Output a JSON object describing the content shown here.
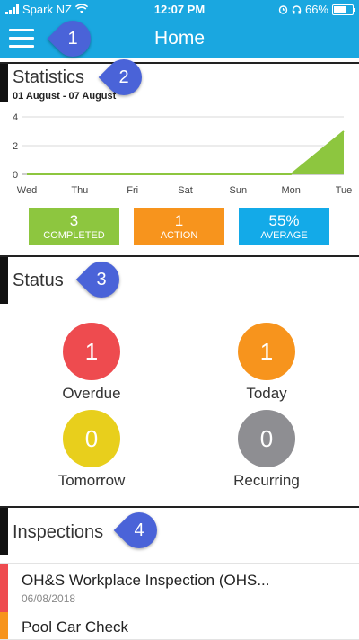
{
  "status_bar": {
    "carrier": "Spark NZ",
    "time": "12:07 PM",
    "battery": "66%"
  },
  "header": {
    "title": "Home",
    "menu_icon": "hamburger-icon"
  },
  "callouts": [
    "1",
    "2",
    "3",
    "4"
  ],
  "statistics": {
    "title": "Statistics",
    "date_range": "01 August - 07 August",
    "stats": [
      {
        "value": "3",
        "label": "COMPLETED",
        "color": "#8dc63f"
      },
      {
        "value": "1",
        "label": "ACTION",
        "color": "#f7941d"
      },
      {
        "value": "55%",
        "label": "AVERAGE",
        "color": "#13aae8"
      }
    ]
  },
  "chart_data": {
    "type": "area",
    "categories": [
      "Wed",
      "Thu",
      "Fri",
      "Sat",
      "Sun",
      "Mon",
      "Tue"
    ],
    "values": [
      0,
      0,
      0,
      0,
      0,
      0,
      3
    ],
    "y_ticks": [
      "0",
      "2",
      "4"
    ],
    "ylim": [
      0,
      4
    ],
    "grid": true,
    "color": "#8dc63f"
  },
  "status": {
    "title": "Status",
    "items": [
      {
        "value": "1",
        "label": "Overdue",
        "color": "#ee4b4f"
      },
      {
        "value": "1",
        "label": "Today",
        "color": "#f7941d"
      },
      {
        "value": "0",
        "label": "Tomorrow",
        "color": "#e8cf1c"
      },
      {
        "value": "0",
        "label": "Recurring",
        "color": "#8e8e92"
      }
    ]
  },
  "inspections": {
    "title": "Inspections",
    "items": [
      {
        "name": "OH&S Workplace Inspection (OHS...",
        "date": "06/08/2018",
        "color": "#ee4b4f"
      },
      {
        "name": "Pool Car Check",
        "date": "",
        "color": "#f7941d"
      }
    ]
  }
}
